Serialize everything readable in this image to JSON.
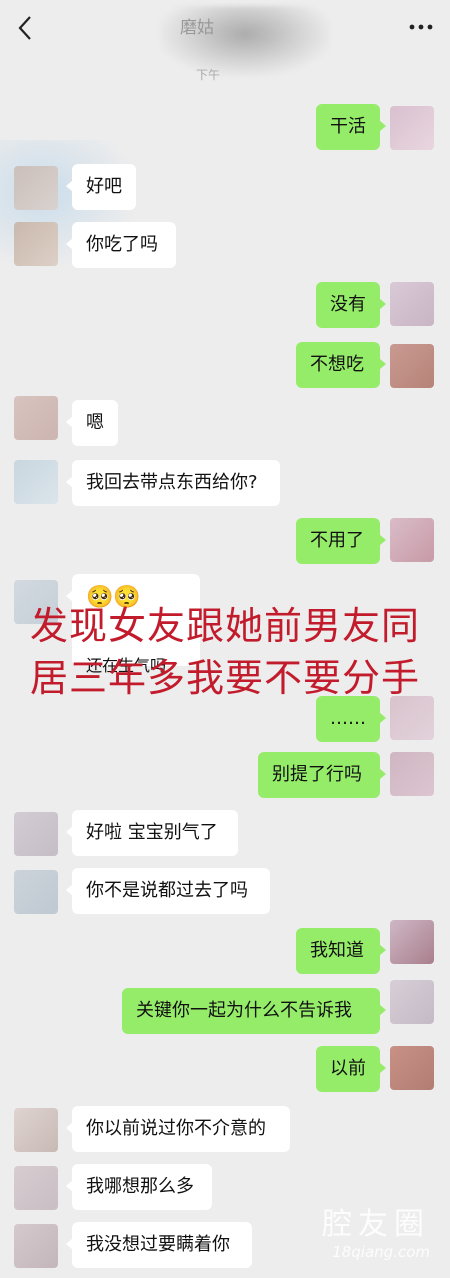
{
  "header": {
    "title": "磨姑",
    "time": "下午"
  },
  "messages": [
    {
      "side": "out",
      "text": "干活"
    },
    {
      "side": "in",
      "text": "好吧"
    },
    {
      "side": "in",
      "text": "你吃了吗"
    },
    {
      "side": "out",
      "text": "没有"
    },
    {
      "side": "out",
      "text": "不想吃"
    },
    {
      "side": "in",
      "text": "嗯"
    },
    {
      "side": "in",
      "text": "我回去带点东西给你?"
    },
    {
      "side": "out",
      "text": "不用了"
    },
    {
      "side": "in",
      "emoji": "🥺🥺",
      "text": "还在生气吗"
    },
    {
      "side": "out",
      "text": "……"
    },
    {
      "side": "out",
      "text": "别提了行吗"
    },
    {
      "side": "in",
      "text": "好啦 宝宝别气了"
    },
    {
      "side": "in",
      "text": "你不是说都过去了吗"
    },
    {
      "side": "out",
      "text": "我知道"
    },
    {
      "side": "out",
      "text": "关键你一起为什么不告诉我"
    },
    {
      "side": "out",
      "text": "以前"
    },
    {
      "side": "in",
      "text": "你以前说过你不介意的"
    },
    {
      "side": "in",
      "text": "我哪想那么多"
    },
    {
      "side": "in",
      "text": "我没想过要瞒着你"
    }
  ],
  "overlay": {
    "line1": "发现女友跟她前男友同",
    "line2": "居三年多我要不要分手",
    "color": "#c21c2c"
  },
  "watermark": {
    "line1": "腔友圈",
    "line2": "18qiang.com"
  },
  "colors": {
    "background": "#ededed",
    "out_bubble": "#95ec69",
    "in_bubble": "#ffffff"
  },
  "icons": {
    "back": "chevron-left-icon",
    "more": "more-dots-icon"
  }
}
